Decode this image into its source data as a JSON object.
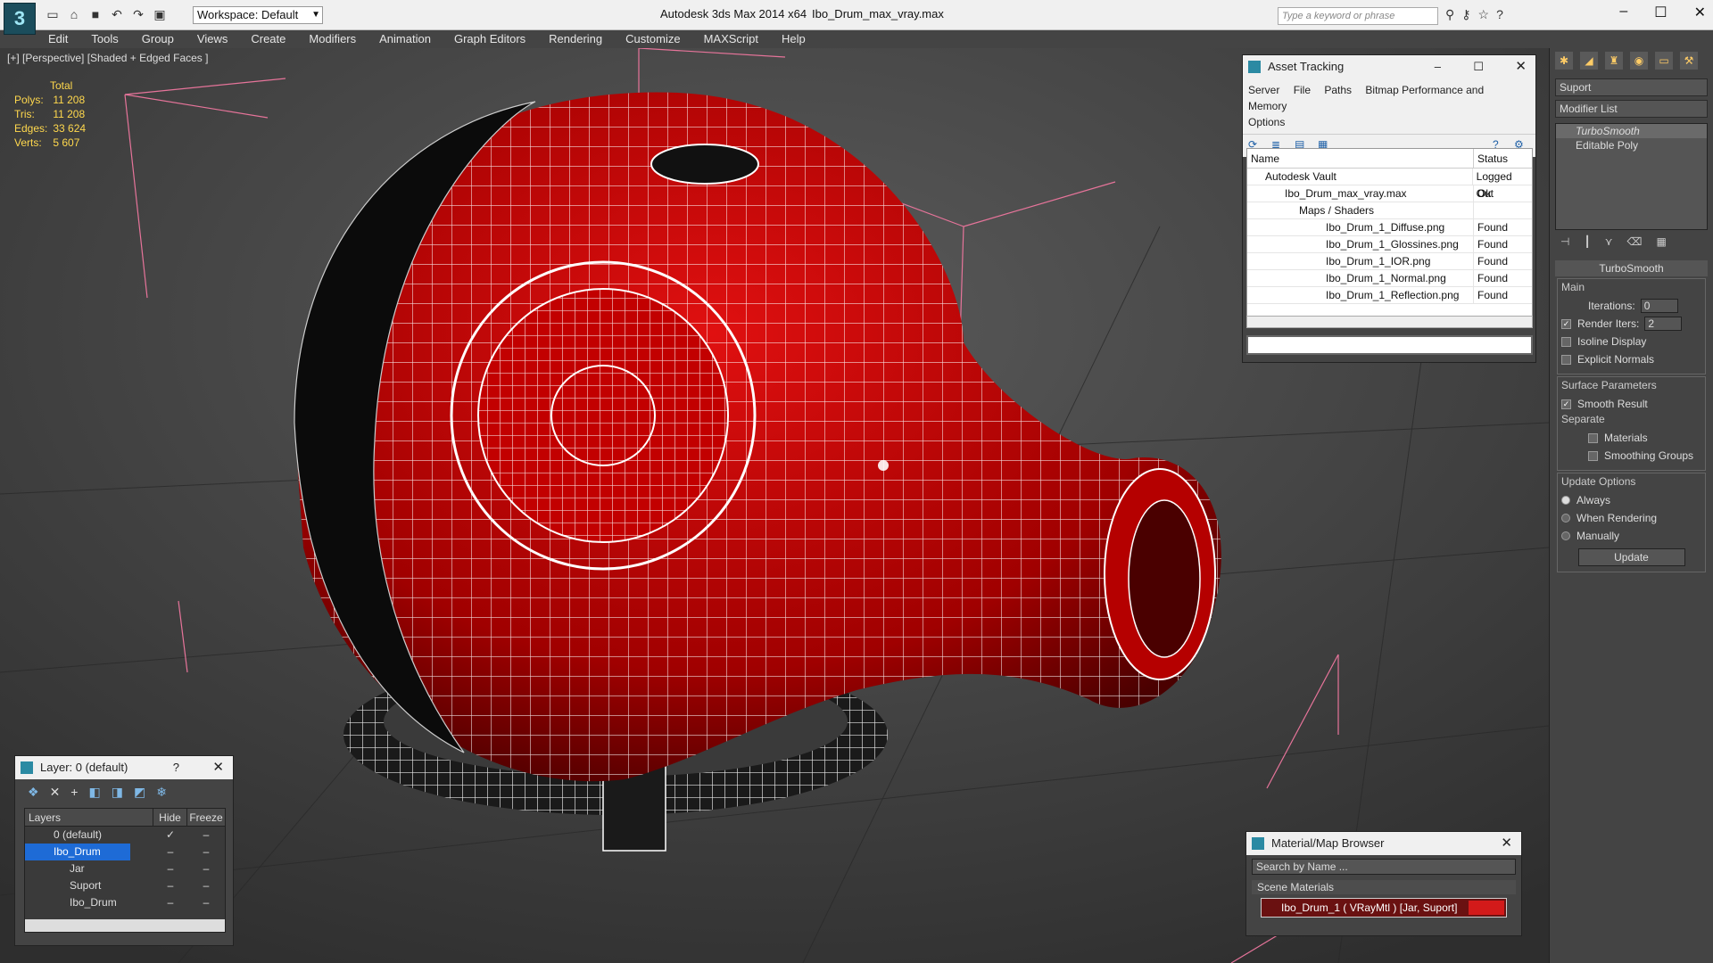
{
  "titlebar": {
    "app_title": "Autodesk 3ds Max  2014 x64",
    "file_name": "Ibo_Drum_max_vray.max",
    "workspace": "Workspace: Default",
    "search_placeholder": "Type a keyword or phrase"
  },
  "menu": [
    "Edit",
    "Tools",
    "Group",
    "Views",
    "Create",
    "Modifiers",
    "Animation",
    "Graph Editors",
    "Rendering",
    "Customize",
    "MAXScript",
    "Help"
  ],
  "viewport": {
    "label": "[+] [Perspective] [Shaded + Edged Faces ]",
    "stats_header": "Total",
    "stats": [
      {
        "k": "Polys:",
        "v": "11 208"
      },
      {
        "k": "Tris:",
        "v": "11 208"
      },
      {
        "k": "Edges:",
        "v": "33 624"
      },
      {
        "k": "Verts:",
        "v": "5 607"
      }
    ]
  },
  "asset_tracking": {
    "title": "Asset Tracking",
    "menu": [
      "Server",
      "File",
      "Paths",
      "Bitmap Performance and Memory",
      "Options"
    ],
    "col_name": "Name",
    "col_status": "Status",
    "rows": [
      {
        "name": "Autodesk Vault",
        "status": "Logged Out"
      },
      {
        "name": "Ibo_Drum_max_vray.max",
        "status": "Ok"
      },
      {
        "name": "Maps / Shaders",
        "status": ""
      },
      {
        "name": "Ibo_Drum_1_Diffuse.png",
        "status": "Found"
      },
      {
        "name": "Ibo_Drum_1_Glossines.png",
        "status": "Found"
      },
      {
        "name": "Ibo_Drum_1_IOR.png",
        "status": "Found"
      },
      {
        "name": "Ibo_Drum_1_Normal.png",
        "status": "Found"
      },
      {
        "name": "Ibo_Drum_1_Reflection.png",
        "status": "Found"
      }
    ]
  },
  "command_panel": {
    "object_name": "Suport",
    "modifier_list": "Modifier List",
    "stack": [
      "TurboSmooth",
      "Editable Poly"
    ],
    "rollout": "TurboSmooth",
    "main_label": "Main",
    "iterations_label": "Iterations:",
    "iterations": "0",
    "render_iters_label": "Render Iters:",
    "render_iters": "2",
    "isoline": "Isoline Display",
    "explicit": "Explicit Normals",
    "surface_label": "Surface Parameters",
    "smooth_result": "Smooth Result",
    "separate_label": "Separate",
    "materials": "Materials",
    "smoothing_groups": "Smoothing Groups",
    "update_label": "Update Options",
    "always": "Always",
    "when_rendering": "When Rendering",
    "manually": "Manually",
    "update_btn": "Update"
  },
  "layer_panel": {
    "title": "Layer: 0 (default)",
    "col_layers": "Layers",
    "col_hide": "Hide",
    "col_freeze": "Freeze",
    "rows": [
      "0 (default)",
      "Ibo_Drum",
      "Jar",
      "Suport",
      "Ibo_Drum"
    ]
  },
  "material_browser": {
    "title": "Material/Map Browser",
    "search": "Search by Name ...",
    "section": "Scene Materials",
    "item": "Ibo_Drum_1  ( VRayMtl )  [Jar, Suport]"
  },
  "colors": {
    "accent": "#1e6bd6",
    "drum_red": "#b00000",
    "stats_yellow": "#ffd84d"
  }
}
